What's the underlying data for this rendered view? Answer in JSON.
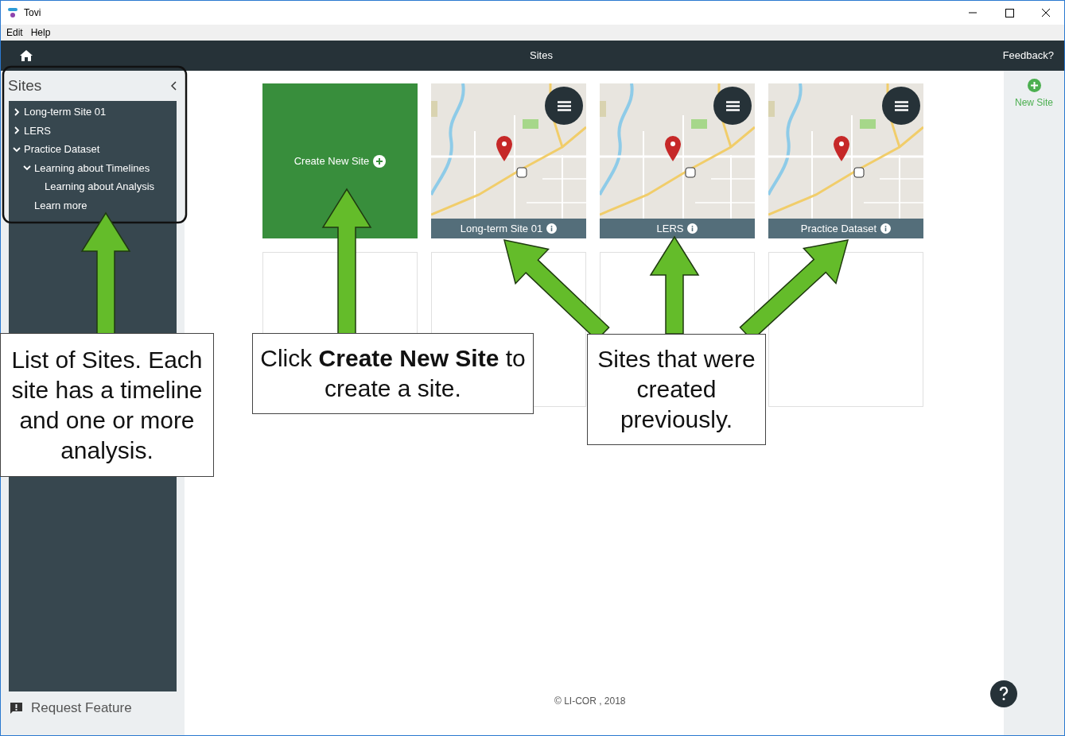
{
  "window": {
    "title": "Tovi"
  },
  "menu": [
    "Edit",
    "Help"
  ],
  "header": {
    "title": "Sites",
    "link": "Feedback?"
  },
  "sidebar": {
    "title": "Sites",
    "tree": [
      {
        "label": "Long-term Site 01",
        "expanded": false
      },
      {
        "label": "LERS",
        "expanded": false
      },
      {
        "label": "Practice Dataset",
        "expanded": true,
        "children": [
          {
            "label": "Learning about Timelines",
            "expanded": true,
            "children": [
              {
                "label": "Learning about Analysis"
              }
            ]
          },
          {
            "label": "Learn more"
          }
        ]
      }
    ],
    "footer": "Request Feature"
  },
  "tiles": [
    {
      "kind": "create",
      "label": "Create New Site"
    },
    {
      "kind": "site",
      "label": "Long-term Site 01"
    },
    {
      "kind": "site",
      "label": "LERS"
    },
    {
      "kind": "site",
      "label": "Practice Dataset"
    },
    {
      "kind": "empty"
    },
    {
      "kind": "empty"
    },
    {
      "kind": "empty"
    },
    {
      "kind": "empty"
    }
  ],
  "copyright": "© LI-COR , 2018",
  "rail": {
    "new_site": "New Site"
  },
  "callouts": [
    {
      "text": "List of Sites. Each site has a timeline and one or more analysis."
    },
    {
      "text": "Click **Create New Site** to create a site."
    },
    {
      "text": "Sites that were created previously."
    }
  ]
}
